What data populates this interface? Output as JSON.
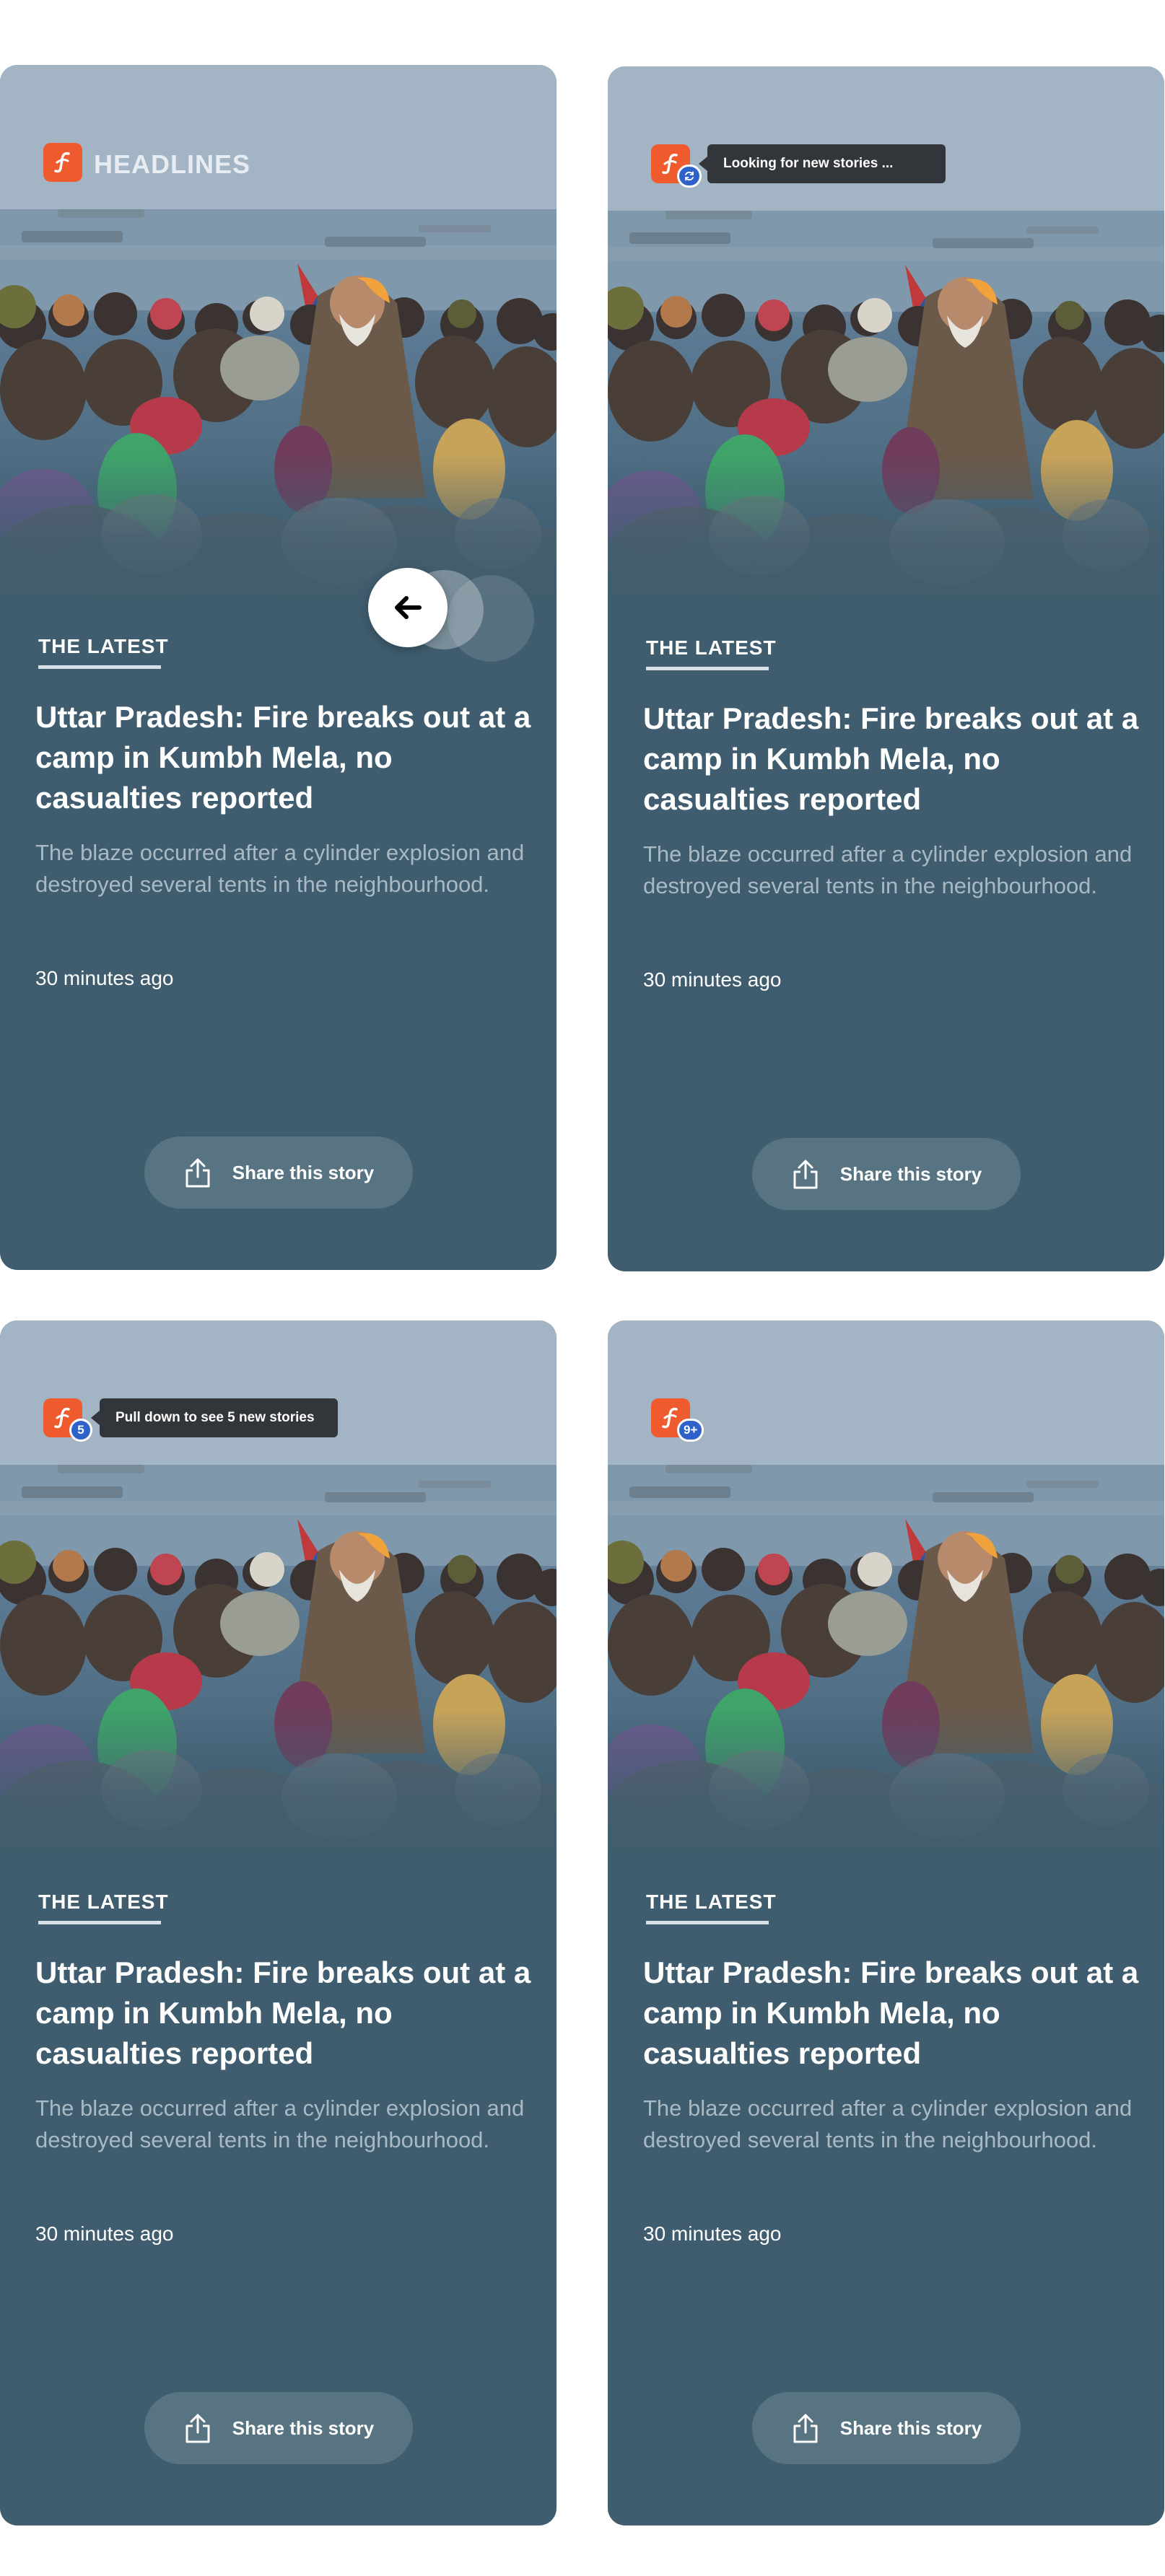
{
  "brand": {
    "name": "HEADLINES",
    "logo_color": "#ef5a2e"
  },
  "story": {
    "eyebrow": "THE LATEST",
    "headline": "Uttar Pradesh: Fire breaks out at a camp in Kumbh Mela, no casualties reported",
    "summary": "The blaze occurred after a cylinder explosion and destroyed several tents in the neighbourhood.",
    "timestamp": "30 minutes ago",
    "share_label": "Share this story",
    "share_icon": "share-icon"
  },
  "states": [
    {
      "id": "default",
      "show_brand_name": true,
      "swipe_hint_icon": "arrow-left-icon"
    },
    {
      "id": "loading",
      "badge_icon": "refresh-icon",
      "tooltip": "Looking for new stories ..."
    },
    {
      "id": "new-stories",
      "badge": "5",
      "tooltip": "Pull down to see 5 new stories"
    },
    {
      "id": "many-new-stories",
      "badge": "9+"
    }
  ],
  "colors": {
    "card_background": "#3f5d6f",
    "badge_background": "#2f62c9",
    "tooltip_background": "#323539",
    "share_button_background": "#587482",
    "summary_text": "#a9b9c4"
  }
}
